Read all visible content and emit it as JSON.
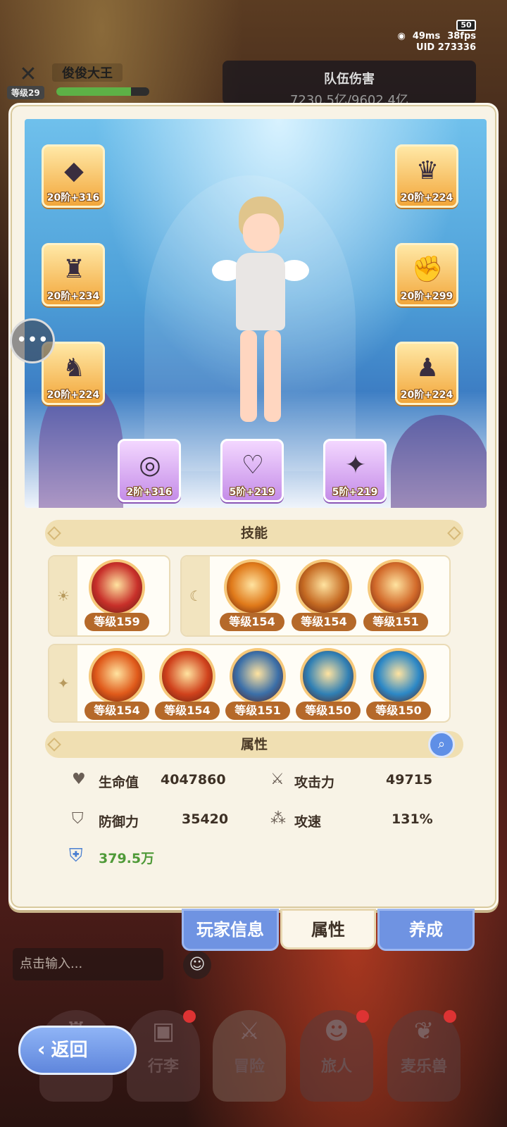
{
  "status": {
    "battery": "50",
    "ping": "49ms",
    "fps": "38fps",
    "uid": "UID 273336"
  },
  "player": {
    "name": "俊俊大王",
    "level": "等级29",
    "xp_fraction": 0.8
  },
  "team_damage": {
    "title": "队伍伤害",
    "value": "7230.5亿/9602.4亿"
  },
  "equipment": {
    "left": [
      {
        "label": "20阶+316",
        "icon": "helmet-icon"
      },
      {
        "label": "20阶+234",
        "icon": "armor-icon"
      },
      {
        "label": "20阶+224",
        "icon": "pants-icon"
      }
    ],
    "right": [
      {
        "label": "20阶+224",
        "icon": "horned-helmet-icon"
      },
      {
        "label": "20阶+299",
        "icon": "gauntlet-icon"
      },
      {
        "label": "20阶+224",
        "icon": "boots-icon"
      }
    ],
    "bottom": [
      {
        "label": "2阶+316",
        "icon": "ring-icon"
      },
      {
        "label": "5阶+219",
        "icon": "necklace-icon"
      },
      {
        "label": "5阶+219",
        "icon": "amulet-icon"
      }
    ]
  },
  "skills": {
    "title": "技能",
    "sun": [
      {
        "level": "等级159",
        "color": "#c8302a"
      }
    ],
    "moon": [
      {
        "level": "等级154",
        "color": "#e07a1a"
      },
      {
        "level": "等级154",
        "color": "#c56a22"
      },
      {
        "level": "等级151",
        "color": "#d26a2a"
      }
    ],
    "star": [
      {
        "level": "等级154",
        "color": "#e05a1a"
      },
      {
        "level": "等级154",
        "color": "#d0421c"
      },
      {
        "level": "等级151",
        "color": "#3b6fa8"
      },
      {
        "level": "等级150",
        "color": "#2f7fb4"
      },
      {
        "level": "等级150",
        "color": "#2c88c6"
      }
    ]
  },
  "attributes": {
    "title": "属性",
    "hp_label": "生命值",
    "hp_value": "4047860",
    "atk_label": "攻击力",
    "atk_value": "49715",
    "def_label": "防御力",
    "def_value": "35420",
    "spd_label": "攻速",
    "spd_value": "131%",
    "power_value": "379.5万"
  },
  "tabs": {
    "player_info": "玩家信息",
    "attributes": "属性",
    "growth": "养成"
  },
  "chat": {
    "placeholder": "点击输入..."
  },
  "nav": {
    "back": "返回",
    "bag": "行李",
    "adventure": "冒险",
    "travelers": "旅人",
    "pets": "麦乐兽"
  }
}
